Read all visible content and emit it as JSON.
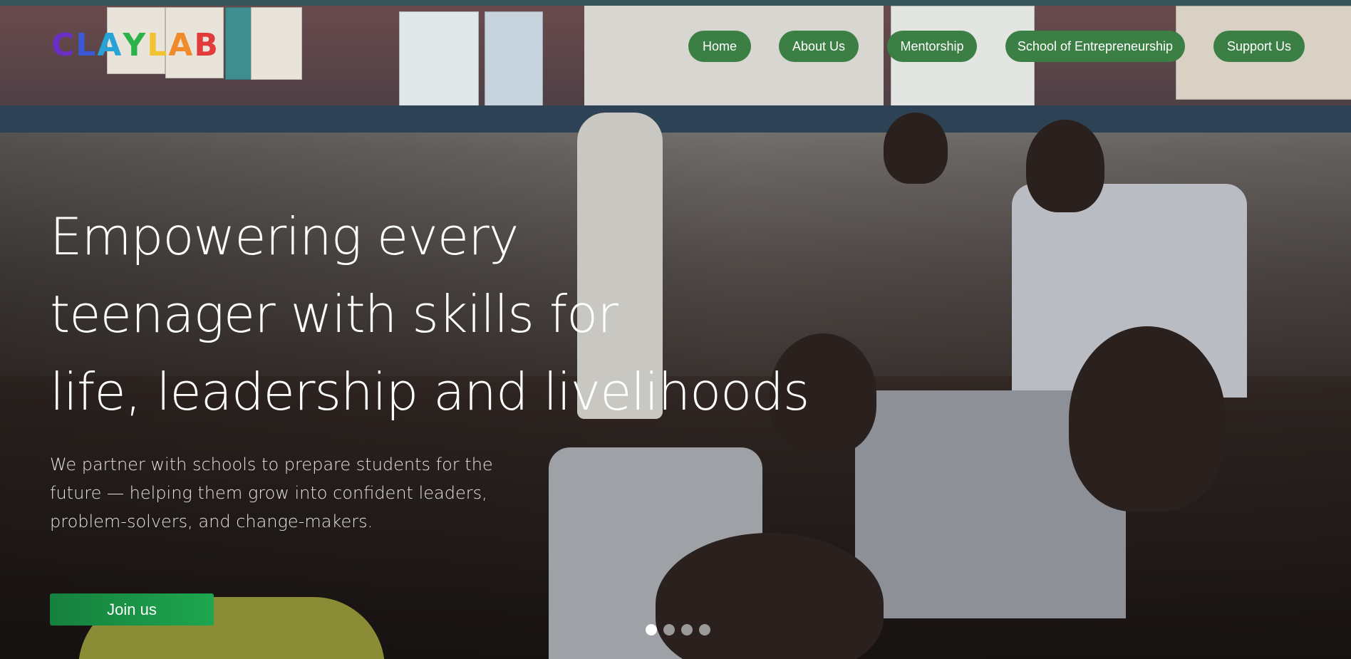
{
  "logo": {
    "text": "CLAYLAB",
    "letters": [
      {
        "char": "C",
        "color": "#6a2fc4"
      },
      {
        "char": "L",
        "color": "#3b58d6"
      },
      {
        "char": "A",
        "color": "#27a3d8"
      },
      {
        "char": "Y",
        "color": "#2bb34a"
      },
      {
        "char": "L",
        "color": "#f2c230"
      },
      {
        "char": "A",
        "color": "#f08a2a"
      },
      {
        "char": "B",
        "color": "#e23b3b"
      }
    ]
  },
  "nav": {
    "items": [
      {
        "label": "Home"
      },
      {
        "label": "About Us"
      },
      {
        "label": "Mentorship"
      },
      {
        "label": "School of Entrepreneurship"
      },
      {
        "label": "Support Us"
      }
    ]
  },
  "hero": {
    "headline_lines": [
      "Empowering every",
      "teenager with skills for",
      "life, leadership and livelihoods"
    ],
    "subtext_lines": [
      "We partner with schools to prepare students for the",
      "future — helping them grow into confident leaders,",
      "problem-solvers, and change-makers."
    ],
    "cta_label": "Join us"
  },
  "carousel": {
    "slide_count": 4,
    "active_index": 0
  },
  "colors": {
    "nav_button": "#3c7f45",
    "cta_start": "#15803d",
    "cta_end": "#1ea64e",
    "dot_active": "#ffffff",
    "dot_inactive": "#9a9a9a"
  }
}
